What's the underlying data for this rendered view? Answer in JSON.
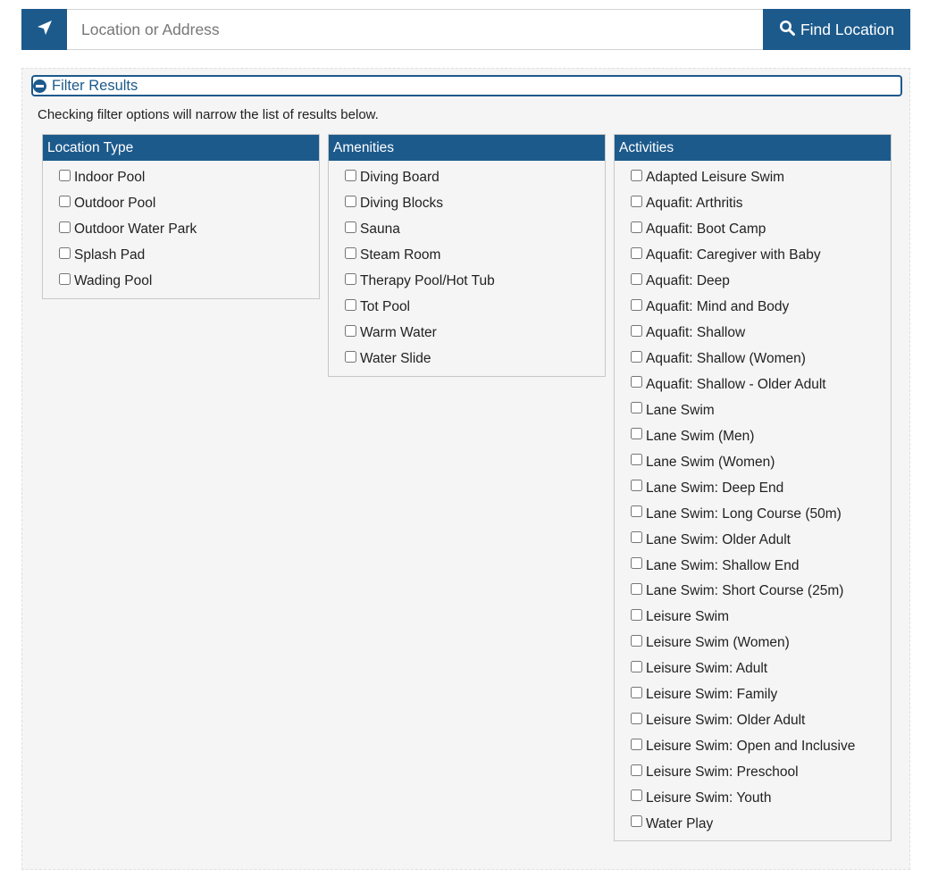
{
  "search": {
    "placeholder": "Location or Address",
    "value": "",
    "locate_icon": "location-arrow-icon",
    "find_icon": "search-icon",
    "find_label": "Find Location"
  },
  "filter": {
    "toggle_icon": "minus-circle-icon",
    "toggle_label": "Filter Results",
    "hint": "Checking filter options will narrow the list of results below.",
    "groups": [
      {
        "title": "Location Type",
        "options": [
          "Indoor Pool",
          "Outdoor Pool",
          "Outdoor Water Park",
          "Splash Pad",
          "Wading Pool"
        ]
      },
      {
        "title": "Amenities",
        "options": [
          "Diving Board",
          "Diving Blocks",
          "Sauna",
          "Steam Room",
          "Therapy Pool/Hot Tub",
          "Tot Pool",
          "Warm Water",
          "Water Slide"
        ]
      },
      {
        "title": "Activities",
        "options": [
          "Adapted Leisure Swim",
          "Aquafit: Arthritis",
          "Aquafit: Boot Camp",
          "Aquafit: Caregiver with Baby",
          "Aquafit: Deep",
          "Aquafit: Mind and Body",
          "Aquafit: Shallow",
          "Aquafit: Shallow (Women)",
          "Aquafit: Shallow - Older Adult",
          "Lane Swim",
          "Lane Swim (Men)",
          "Lane Swim (Women)",
          "Lane Swim: Deep End",
          "Lane Swim: Long Course (50m)",
          "Lane Swim: Older Adult",
          "Lane Swim: Shallow End",
          "Lane Swim: Short Course (25m)",
          "Leisure Swim",
          "Leisure Swim (Women)",
          "Leisure Swim: Adult",
          "Leisure Swim: Family",
          "Leisure Swim: Older Adult",
          "Leisure Swim: Open and Inclusive",
          "Leisure Swim: Preschool",
          "Leisure Swim: Youth",
          "Water Play"
        ]
      }
    ]
  },
  "colors": {
    "brand": "#1c5a8c",
    "panel_bg": "#f5f5f5"
  }
}
